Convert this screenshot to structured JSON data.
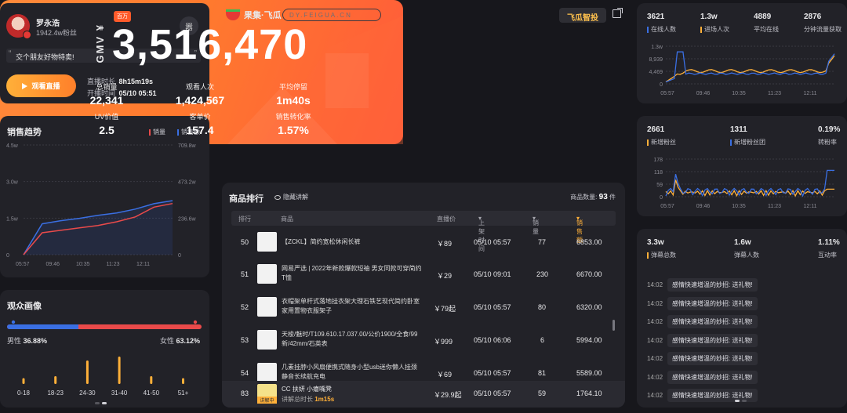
{
  "profile": {
    "name": "罗永浩",
    "fans": "1942.4w粉丝",
    "qr_label": "嚣",
    "slogan": "交个朋友好物特卖!",
    "watch_button": "观看直播",
    "live_duration_label": "直播时长",
    "live_duration": "8h15m19s",
    "start_time_label": "开播时间",
    "start_time": "05/10 05:51"
  },
  "header": {
    "logo": "果集·飞瓜",
    "domain": "DY.FEIGUA.CN",
    "pro_button": "飞瓜智投"
  },
  "kpi": {
    "gmv_label": "GMV ¥",
    "tag": "百万",
    "gmv": "3,516,470",
    "items": [
      {
        "label": "总销量",
        "value": "22,341"
      },
      {
        "label": "观看人次",
        "value": "1,424,567"
      },
      {
        "label": "平均停留",
        "value": "1m40s"
      },
      {
        "label": "UV价值",
        "value": "2.5"
      },
      {
        "label": "客单价",
        "value": "157.4"
      },
      {
        "label": "销售转化率",
        "value": "1.57%"
      }
    ]
  },
  "trend": {
    "title": "销售趋势",
    "legend_sales": "销量",
    "legend_amount": "销售额",
    "colors": {
      "sales": "#e94a4a",
      "amount": "#3a6fe3"
    }
  },
  "chart_data": [
    {
      "type": "line",
      "title": "销售趋势",
      "x_ticks": [
        "05:57",
        "09:46",
        "10:35",
        "11:23",
        "12:11"
      ],
      "y_left_ticks": [
        "0",
        "1.5w",
        "3.0w",
        "4.5w"
      ],
      "y_right_ticks": [
        "0",
        "236.6w",
        "473.2w",
        "709.8w"
      ],
      "ylim_left": [
        0,
        45000
      ],
      "ylim_right": [
        0,
        7098000
      ],
      "series": [
        {
          "name": "销量",
          "values": [
            0,
            9000,
            10000,
            11000,
            12000,
            13500,
            15500,
            19500,
            21000
          ]
        },
        {
          "name": "销售额",
          "values": [
            0,
            2000000,
            2200000,
            2350000,
            2550000,
            2700000,
            2950000,
            3300000,
            3500000
          ]
        }
      ]
    },
    {
      "type": "line",
      "title": "",
      "x_ticks": [
        "05:57",
        "09:46",
        "10:35",
        "11:23",
        "12:11"
      ],
      "y_ticks": [
        "0",
        "4,469",
        "8,939",
        "1.3w"
      ],
      "ylim": [
        0,
        13000
      ]
    },
    {
      "type": "line",
      "title": "",
      "x_ticks": [
        "05:57",
        "09:46",
        "10:35",
        "11:23",
        "12:11"
      ],
      "y_ticks": [
        "0",
        "59",
        "118",
        "178"
      ],
      "ylim": [
        0,
        178
      ]
    },
    {
      "type": "bar",
      "title": "观众画像",
      "categories": [
        "0-18",
        "18-23",
        "24-30",
        "31-40",
        "41-50",
        "51+"
      ],
      "values": [
        1.5,
        2,
        6,
        7,
        2,
        1.5
      ]
    }
  ],
  "audience": {
    "title": "观众画像",
    "male_label": "男性",
    "male_pct": "36.88%",
    "female_label": "女性",
    "female_pct": "63.12%",
    "male_fraction": 0.3688,
    "age_groups": [
      "0-18",
      "18-23",
      "24-30",
      "31-40",
      "41-50",
      "51+"
    ]
  },
  "products": {
    "title": "商品排行",
    "hide_toggle": "隐藏讲解",
    "count_label": "商品数量:",
    "count": "93",
    "count_unit": "件",
    "columns": [
      "排行",
      "商品",
      "直播价",
      "上架时间",
      "销量",
      "销售额"
    ],
    "rows": [
      {
        "rank": "50",
        "name": "【ZCKL】简约宽松休闲长裤",
        "price": "￥89",
        "time": "05/10 05:57",
        "sales": "77",
        "amount": "6853.00"
      },
      {
        "rank": "51",
        "name": "网易严选 | 2022年新款爆款短袖 男女同款可穿简约T恤",
        "price": "￥29",
        "time": "05/10 09:01",
        "sales": "230",
        "amount": "6670.00"
      },
      {
        "rank": "52",
        "name": "衣帽架单杆式落地挂衣架大理石铁艺现代简约卧室家用置物衣服架子",
        "price": "￥79起",
        "time": "05/10 05:57",
        "sales": "80",
        "amount": "6320.00"
      },
      {
        "rank": "53",
        "name": "天梭/魅时/T109.610.17.037.00/公价1900/全食/99新/42mm/石英表",
        "price": "￥999",
        "time": "05/10 06:06",
        "sales": "6",
        "amount": "5994.00"
      },
      {
        "rank": "54",
        "name": "几素挂脖小风扇便携式随身小型usb迷你懒人挂颈静音长续航充电",
        "price": "￥69",
        "time": "05/10 05:57",
        "sales": "81",
        "amount": "5589.00"
      }
    ],
    "current": {
      "rank": "83",
      "name": "CC 扶妍 小瘪嘴凳",
      "tag": "讲解中",
      "sub_label": "讲解总时长",
      "sub_value": "1m15s",
      "price": "￥29.9起",
      "time": "05/10 05:57",
      "sales": "59",
      "amount": "1764.10"
    }
  },
  "right1": {
    "stats": [
      {
        "value": "3621",
        "label": "在线人数",
        "color": "#3a6fe3"
      },
      {
        "value": "1.3w",
        "label": "进场人次",
        "color": "#ffb039"
      },
      {
        "value": "4889",
        "label": "平均在线",
        "color": ""
      },
      {
        "value": "2876",
        "label": "分钟流量获取",
        "color": ""
      }
    ]
  },
  "right2": {
    "stats": [
      {
        "value": "2661",
        "label": "新增粉丝",
        "color": "#ffb039"
      },
      {
        "value": "1311",
        "label": "新增粉丝团",
        "color": "#3a6fe3"
      },
      {
        "value": "0.19%",
        "label": "转粉率",
        "color": ""
      }
    ]
  },
  "right3": {
    "stats": [
      {
        "value": "3.3w",
        "label": "弹幕总数",
        "color": "#ffb039"
      },
      {
        "value": "1.6w",
        "label": "弹幕人数",
        "color": ""
      },
      {
        "value": "1.11%",
        "label": "互动率",
        "color": ""
      }
    ],
    "comments": [
      {
        "time": "14:02",
        "text": "感情快速增温的妙招: 送礼物!"
      },
      {
        "time": "14:02",
        "text": "感情快速增温的妙招: 送礼物!"
      },
      {
        "time": "14:02",
        "text": "感情快速增温的妙招: 送礼物!"
      },
      {
        "time": "14:02",
        "text": "感情快速增温的妙招: 送礼物!"
      },
      {
        "time": "14:02",
        "text": "感情快速增温的妙招: 送礼物!"
      },
      {
        "time": "14:02",
        "text": "感情快速增温的妙招: 送礼物!"
      },
      {
        "time": "14:02",
        "text": "感情快速增温的妙招: 送礼物!"
      },
      {
        "time": "14:02",
        "text": "感情快速增温的妙招: 送礼物!"
      }
    ]
  }
}
